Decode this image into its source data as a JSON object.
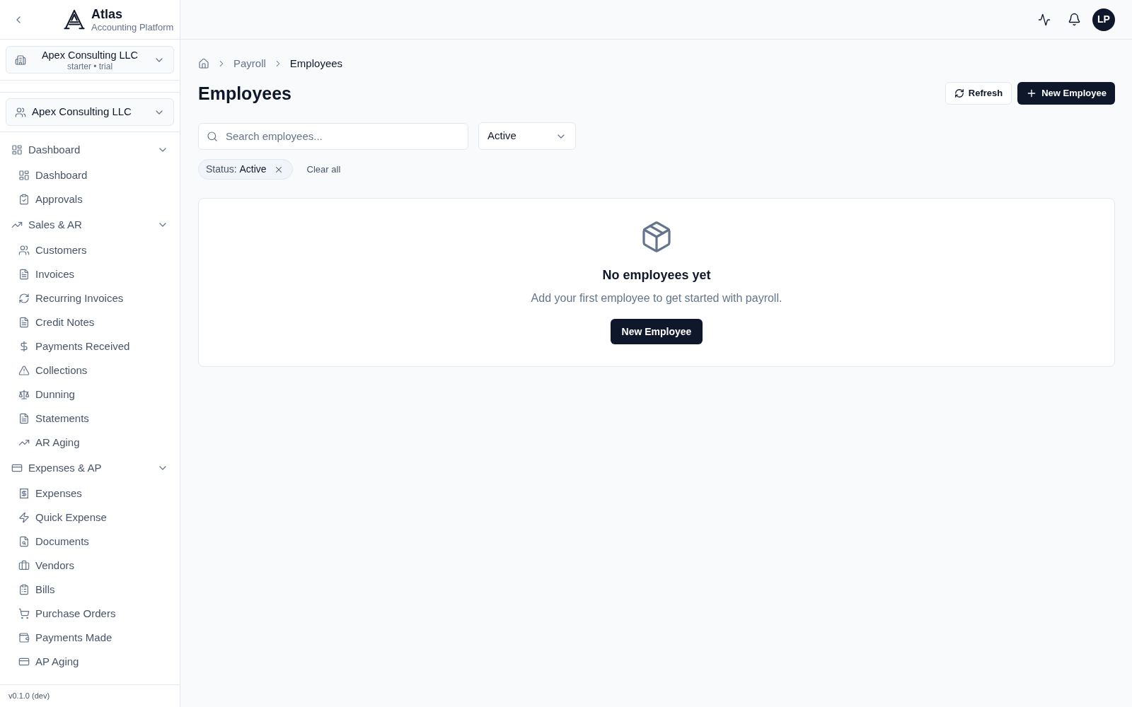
{
  "sidebar": {
    "brand": {
      "name": "Atlas",
      "tagline": "Accounting Platform"
    },
    "org_switcher": {
      "name": "Apex Consulting LLC",
      "plan": "starter • trial"
    },
    "client_switcher": {
      "name": "Apex Consulting LLC"
    },
    "nav": [
      {
        "label": "Dashboard",
        "expanded": true,
        "children": [
          {
            "label": "Dashboard"
          },
          {
            "label": "Approvals"
          }
        ]
      },
      {
        "label": "Sales & AR",
        "expanded": true,
        "children": [
          {
            "label": "Customers"
          },
          {
            "label": "Invoices"
          },
          {
            "label": "Recurring Invoices"
          },
          {
            "label": "Credit Notes"
          },
          {
            "label": "Payments Received"
          },
          {
            "label": "Collections"
          },
          {
            "label": "Dunning"
          },
          {
            "label": "Statements"
          },
          {
            "label": "AR Aging"
          }
        ]
      },
      {
        "label": "Expenses & AP",
        "expanded": true,
        "children": [
          {
            "label": "Expenses"
          },
          {
            "label": "Quick Expense"
          },
          {
            "label": "Documents"
          },
          {
            "label": "Vendors"
          },
          {
            "label": "Bills"
          },
          {
            "label": "Purchase Orders"
          },
          {
            "label": "Payments Made"
          },
          {
            "label": "AP Aging"
          }
        ]
      }
    ],
    "version": "v0.1.0 (dev)"
  },
  "topbar": {
    "avatar": "LP"
  },
  "breadcrumb": [
    {
      "label": "Payroll",
      "current": false
    },
    {
      "label": "Employees",
      "current": true
    }
  ],
  "page": {
    "title": "Employees",
    "actions": [
      {
        "label": "Refresh",
        "kind": "secondary"
      },
      {
        "label": "New Employee",
        "kind": "primary"
      }
    ]
  },
  "filters": {
    "search": {
      "placeholder": "Search employees..."
    },
    "status": {
      "value": "Active"
    },
    "chips": [
      {
        "text": "Status: **Active**"
      }
    ],
    "clear_all": "Clear all"
  },
  "empty_state": {
    "title": "No employees yet",
    "message": "Add your first employee to get started with payroll.",
    "button": "New Employee"
  }
}
